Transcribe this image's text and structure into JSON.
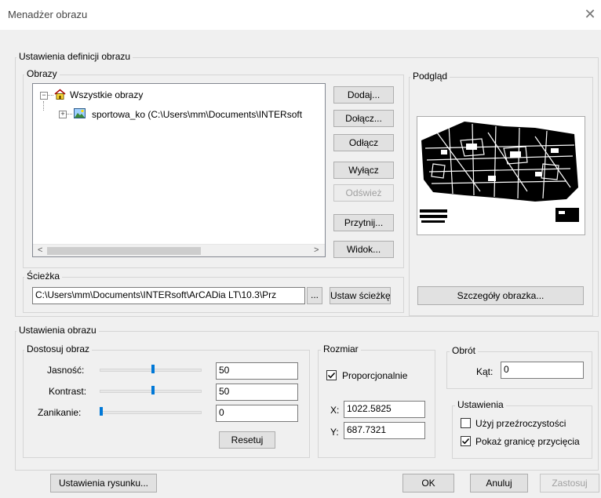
{
  "window": {
    "title": "Menadżer obrazu",
    "close_glyph": "✕"
  },
  "definition": {
    "group_title": "Ustawienia definicji obrazu",
    "images_title": "Obrazy",
    "tree": {
      "root_label": "Wszystkie obrazy",
      "child_label": "sportowa_ko  (C:\\Users\\mm\\Documents\\INTERsoft"
    },
    "buttons": {
      "add": "Dodaj...",
      "attach": "Dołącz...",
      "detach": "Odłącz",
      "unload": "Wyłącz",
      "reload": "Odśwież",
      "clip": "Przytnij...",
      "view": "Widok..."
    },
    "path": {
      "group_title": "Ścieżka",
      "value": "C:\\Users\\mm\\Documents\\INTERsoft\\ArCADia LT\\10.3\\Prz",
      "browse_label": "...",
      "set_path_label": "Ustaw ścieżkę"
    },
    "preview": {
      "group_title": "Podgląd",
      "details_label": "Szczegóły obrazka..."
    }
  },
  "image_settings": {
    "group_title": "Ustawienia obrazu",
    "adjust": {
      "group_title": "Dostosuj obraz",
      "brightness_label": "Jasność:",
      "brightness_value": "50",
      "brightness_level": 50,
      "contrast_label": "Kontrast:",
      "contrast_value": "50",
      "contrast_level": 50,
      "fade_label": "Zanikanie:",
      "fade_value": "0",
      "fade_level": 0,
      "reset_label": "Resetuj"
    },
    "size": {
      "group_title": "Rozmiar",
      "proportional_label": "Proporcjonalnie",
      "proportional_checked": true,
      "x_label": "X:",
      "x_value": "1022.5825",
      "y_label": "Y:",
      "y_value": "687.7321"
    },
    "rotation": {
      "group_title": "Obrót",
      "angle_label": "Kąt:",
      "angle_value": "0"
    },
    "settings": {
      "group_title": "Ustawienia",
      "transparency_label": "Użyj przeźroczystości",
      "transparency_checked": false,
      "show_clip_label": "Pokaż granicę przycięcia",
      "show_clip_checked": true
    }
  },
  "footer": {
    "drawing_settings": "Ustawienia rysunku...",
    "ok": "OK",
    "cancel": "Anuluj",
    "apply": "Zastosuj"
  },
  "colors": {
    "accent": "#0078d7",
    "disabled_text": "#a0a0a0"
  }
}
